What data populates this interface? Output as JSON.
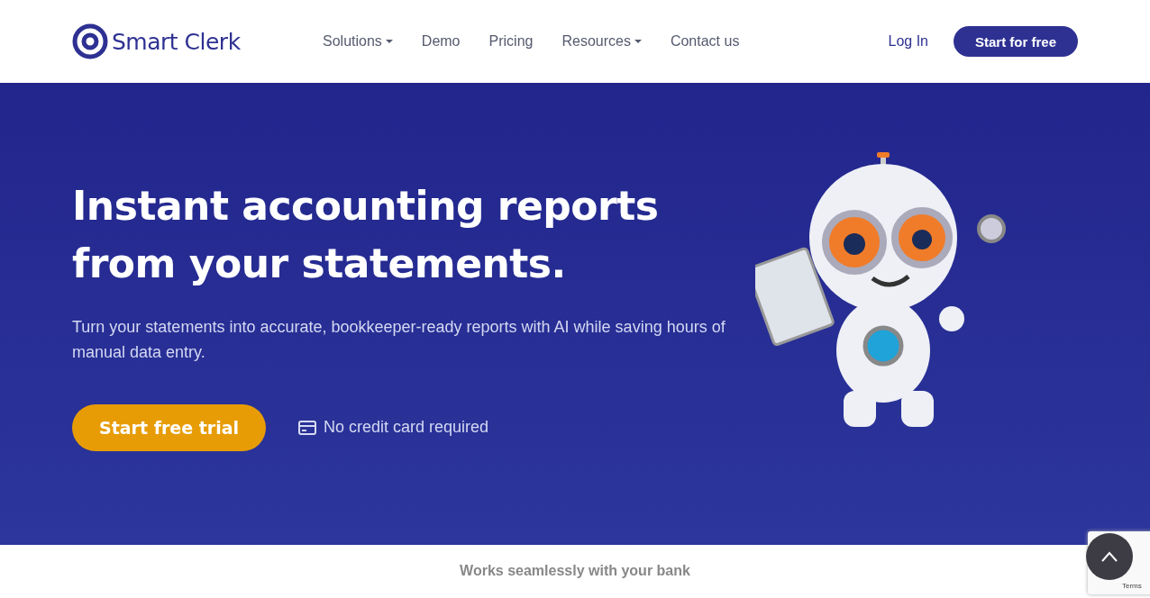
{
  "header": {
    "logo": "Smart Clerk",
    "nav": [
      {
        "label": "Solutions",
        "kind": "dropdown"
      },
      {
        "label": "Demo",
        "kind": "link"
      },
      {
        "label": "Pricing",
        "kind": "link"
      },
      {
        "label": "Resources",
        "kind": "dropdown"
      },
      {
        "label": "Contact us",
        "kind": "link"
      }
    ],
    "login": "Log In",
    "cta": "Start for free"
  },
  "hero": {
    "title_lines": [
      "Instant accounting reports",
      "from your statements."
    ],
    "subtitle": "Turn your statements into accurate, bookkeeper-ready reports with AI while saving hours of manual data entry.",
    "button": "Start free trial",
    "note": "No credit card required"
  },
  "partners": {
    "heading": "Works seamlessly with your bank"
  },
  "recaptcha": {
    "links": "Terms"
  }
}
